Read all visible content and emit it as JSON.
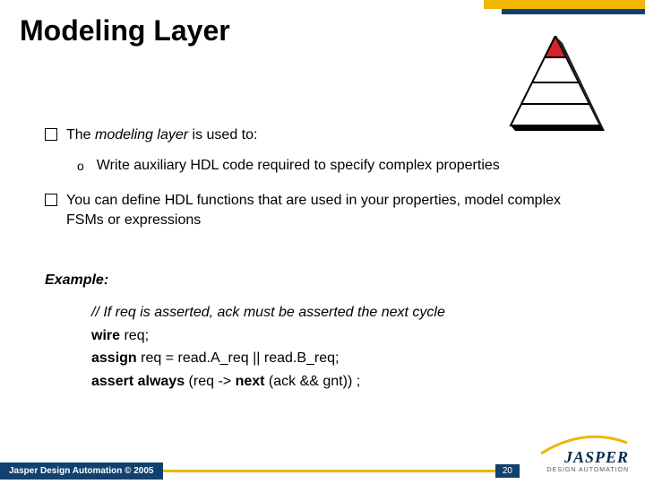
{
  "title": "Modeling Layer",
  "bullets": {
    "b1_pre": "The ",
    "b1_em": "modeling layer",
    "b1_post": " is used to:",
    "b1_sub": "Write auxiliary HDL code required to specify complex properties",
    "b2": "You can define HDL functions that are used in your properties, model complex FSMs or expressions"
  },
  "example": {
    "label": "Example:",
    "comment": "// If req is asserted, ack must be asserted the next cycle",
    "l1_kw": "wire",
    "l1_rest": " req;",
    "l2_kw": "assign",
    "l2_rest": " req = read.A_req || read.B_req;",
    "l3_kw1": "assert",
    "l3_kw2": " always",
    "l3_mid": " (req -> ",
    "l3_kw3": "next",
    "l3_end": " (ack && gnt)) ;"
  },
  "footer": {
    "copyright": "Jasper Design Automation © 2005",
    "page": "20"
  },
  "logo": {
    "main": "JASPER",
    "sub": "DESIGN AUTOMATION"
  }
}
